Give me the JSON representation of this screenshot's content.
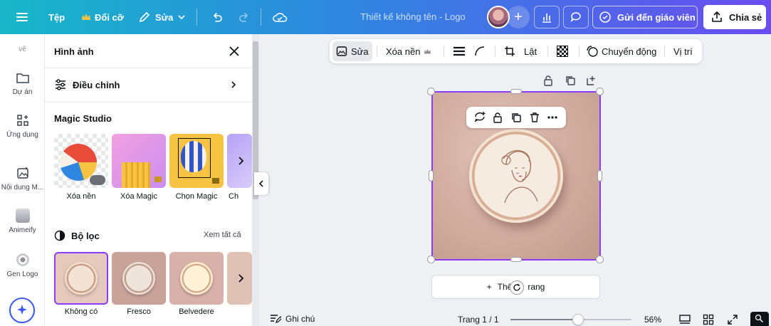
{
  "topbar": {
    "menu_icon": "hamburger-icon",
    "file_label": "Tệp",
    "resize_label": "Đổi cỡ",
    "edit_label": "Sửa",
    "doc_title": "Thiết kế không tên - Logo",
    "send_teacher_label": "Gửi đến giáo viên",
    "share_label": "Chia sẻ"
  },
  "rail": {
    "top_label": "vẽ",
    "items": [
      {
        "label": "Dự án",
        "icon": "folder-icon"
      },
      {
        "label": "Ứng dụng",
        "icon": "apps-icon"
      },
      {
        "label": "Nội dung M...",
        "icon": "magic-media-icon"
      },
      {
        "label": "Animeify",
        "icon": "animeify-icon"
      },
      {
        "label": "Gen Logo",
        "icon": "gen-logo-icon"
      }
    ]
  },
  "panel": {
    "title": "Hình ảnh",
    "adjust_label": "Điều chỉnh",
    "magic_studio_label": "Magic Studio",
    "magic_tools": [
      {
        "label": "Xóa nền"
      },
      {
        "label": "Xóa Magic"
      },
      {
        "label": "Chọn Magic"
      },
      {
        "label": "Ch"
      }
    ],
    "filters_label": "Bộ lọc",
    "see_all_label": "Xem tất cả",
    "filters": [
      {
        "label": "Không có"
      },
      {
        "label": "Fresco"
      },
      {
        "label": "Belvedere"
      }
    ]
  },
  "context_toolbar": {
    "edit_label": "Sửa",
    "remove_bg_label": "Xóa nền",
    "flip_label": "Lật",
    "animate_label": "Chuyển động",
    "position_label": "Vị trí"
  },
  "canvas": {
    "add_page_label": "Thê",
    "add_page_suffix": "rang"
  },
  "bottombar": {
    "notes_label": "Ghi chú",
    "page_info": "Trang 1 / 1",
    "zoom_value": "56%",
    "zoom_fraction": 0.56
  },
  "colors": {
    "accent": "#8b3dff",
    "gradient_start": "#17b7c8",
    "gradient_end": "#6a4df0"
  }
}
